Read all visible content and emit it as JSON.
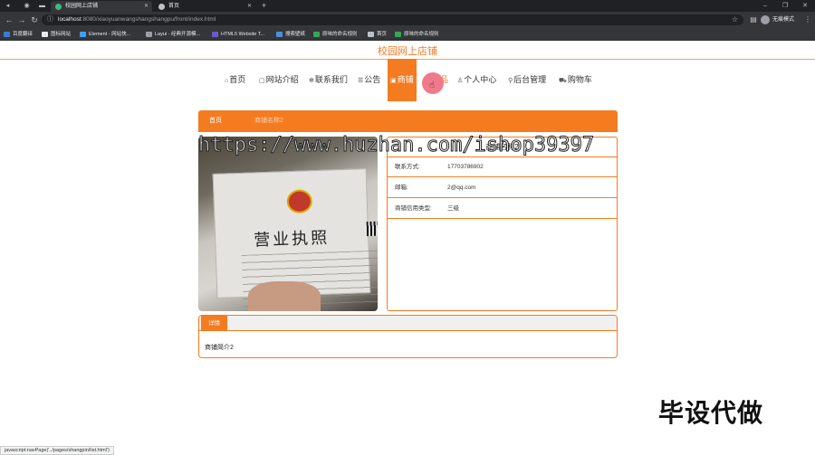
{
  "browser": {
    "tabs": [
      {
        "label": "校园网上店铺",
        "active": true
      },
      {
        "label": "首页",
        "active": false
      }
    ],
    "new_tab": "+",
    "url_host": "localhost",
    "url_rest": ":8080/xiaoyuanwangshangshangpu/front/index.html",
    "profile_label": "无痕模式",
    "bookmarks": [
      "百度翻译",
      "图标网站",
      "Element - 网站快...",
      "Layui - 经典开源模...",
      "HTML5 Website T...",
      "搜索壁纸",
      "原味的命名规则",
      "首页",
      "原味的命名规则"
    ]
  },
  "site": {
    "title": "校园网上店铺",
    "nav": [
      {
        "icon": "⌂",
        "label": "首页"
      },
      {
        "icon": "▢",
        "label": "网站介绍"
      },
      {
        "icon": "✻",
        "label": "联系我们"
      },
      {
        "icon": "☰",
        "label": "公告"
      },
      {
        "icon": "▣",
        "label": "商铺",
        "active": true
      },
      {
        "icon": "",
        "label": "品"
      },
      {
        "icon": "♙",
        "label": "个人中心"
      },
      {
        "icon": "⚲",
        "label": "后台管理"
      },
      {
        "icon": "⛟",
        "label": "购物车"
      }
    ]
  },
  "breadcrumb": {
    "home": "首页",
    "current": "商铺名称2"
  },
  "shop": {
    "name": "商铺名称2",
    "fields": [
      {
        "label": "联系方式:",
        "value": "17703786902"
      },
      {
        "label": "邮箱:",
        "value": "2@qq.com"
      },
      {
        "label": "商铺信用类型:",
        "value": "三级"
      }
    ],
    "image_title": "营业执照"
  },
  "detail": {
    "tab_label": "详情",
    "content": "商铺简介2"
  },
  "overlay": {
    "watermark": "https://www.huzhan.com/ishop39397",
    "stamp": "毕设代做"
  },
  "status_bar": "javascript:navPage('../pages/shangpin/list.html')"
}
